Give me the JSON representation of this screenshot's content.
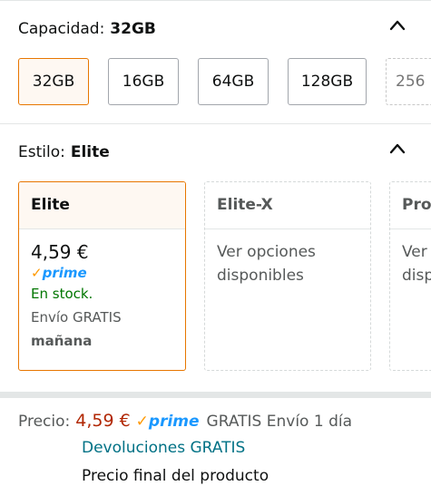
{
  "capacity": {
    "label": "Capacidad:",
    "selected": "32GB",
    "options": [
      "32GB",
      "16GB",
      "64GB",
      "128GB",
      "256"
    ],
    "selected_index": 0
  },
  "style": {
    "label": "Estilo:",
    "selected": "Elite",
    "cards": [
      {
        "name": "Elite",
        "price": "4,59 €",
        "prime": "prime",
        "stock": "En stock.",
        "shipping": "Envío GRATIS",
        "shipping_day": "mañana"
      },
      {
        "name": "Elite-X",
        "options_line1": "Ver opciones",
        "options_line2": "disponibles"
      },
      {
        "name": "Pro",
        "options_line1": "Ver",
        "options_line2": "disp"
      }
    ]
  },
  "price_block": {
    "label": "Precio:",
    "amount": "4,59 €",
    "prime": "prime",
    "shipping": "GRATIS Envío 1 día",
    "returns": "Devoluciones GRATIS",
    "final": "Precio final del producto"
  },
  "colors": {
    "accent_orange": "#e77600",
    "price_red": "#b12704",
    "prime_blue": "#1a98ff",
    "stock_green": "#007600",
    "link_teal": "#007185"
  },
  "icons": {
    "collapse": "chevron-up-icon",
    "prime_check": "check-icon"
  }
}
